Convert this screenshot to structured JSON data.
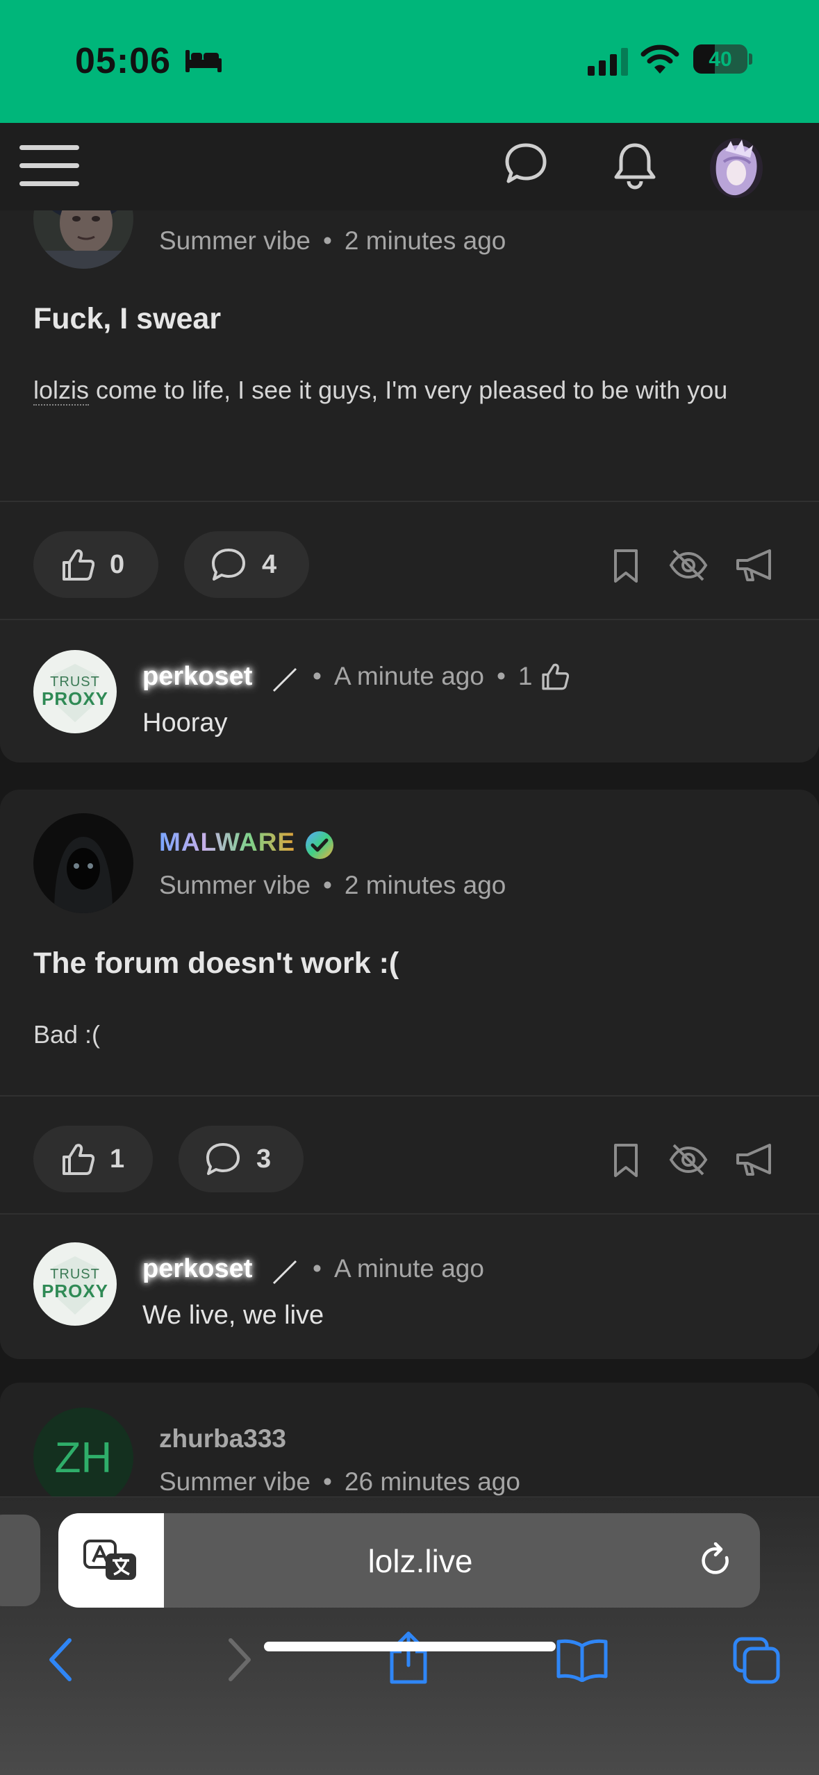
{
  "status_bar": {
    "time": "05:06",
    "battery": "40",
    "battery_level": 0.4,
    "icons": [
      "bed-icon",
      "signal-icon",
      "wifi-icon",
      "battery-icon"
    ],
    "accent": "#00b67a"
  },
  "nav": {
    "icons": [
      "menu-icon",
      "chat-bubble-icon",
      "bell-icon",
      "user-avatar"
    ]
  },
  "posts": [
    {
      "section": "Summer vibe",
      "time": "2 minutes ago",
      "title": "Fuck, I swear",
      "body_link": "lolzis",
      "body_rest": " come to life, I see it guys, I'm very pleased to be with you",
      "likes": "0",
      "comments": "4",
      "comment": {
        "author": "perkoset",
        "time": "A minute ago",
        "likes": "1",
        "text": "Hooray",
        "avatar_line1": "TRUST",
        "avatar_line2": "PROXY"
      }
    },
    {
      "author": "MALWARE",
      "section": "Summer vibe",
      "time": "2 minutes ago",
      "title": "The forum doesn't work :(",
      "body": "Bad :(",
      "likes": "1",
      "comments": "3",
      "comment": {
        "author": "perkoset",
        "time": "A minute ago",
        "text": "We live, we live",
        "avatar_line1": "TRUST",
        "avatar_line2": "PROXY"
      }
    },
    {
      "author": "zhurba333",
      "avatar_initials": "ZH",
      "section": "Summer vibe",
      "time": "26 minutes ago"
    }
  ],
  "meta_separator": "•",
  "browser": {
    "url": "lolz.live",
    "icons": [
      "translate-icon",
      "reload-icon",
      "back-icon",
      "forward-icon",
      "share-icon",
      "bookmarks-icon",
      "tabs-icon"
    ]
  }
}
